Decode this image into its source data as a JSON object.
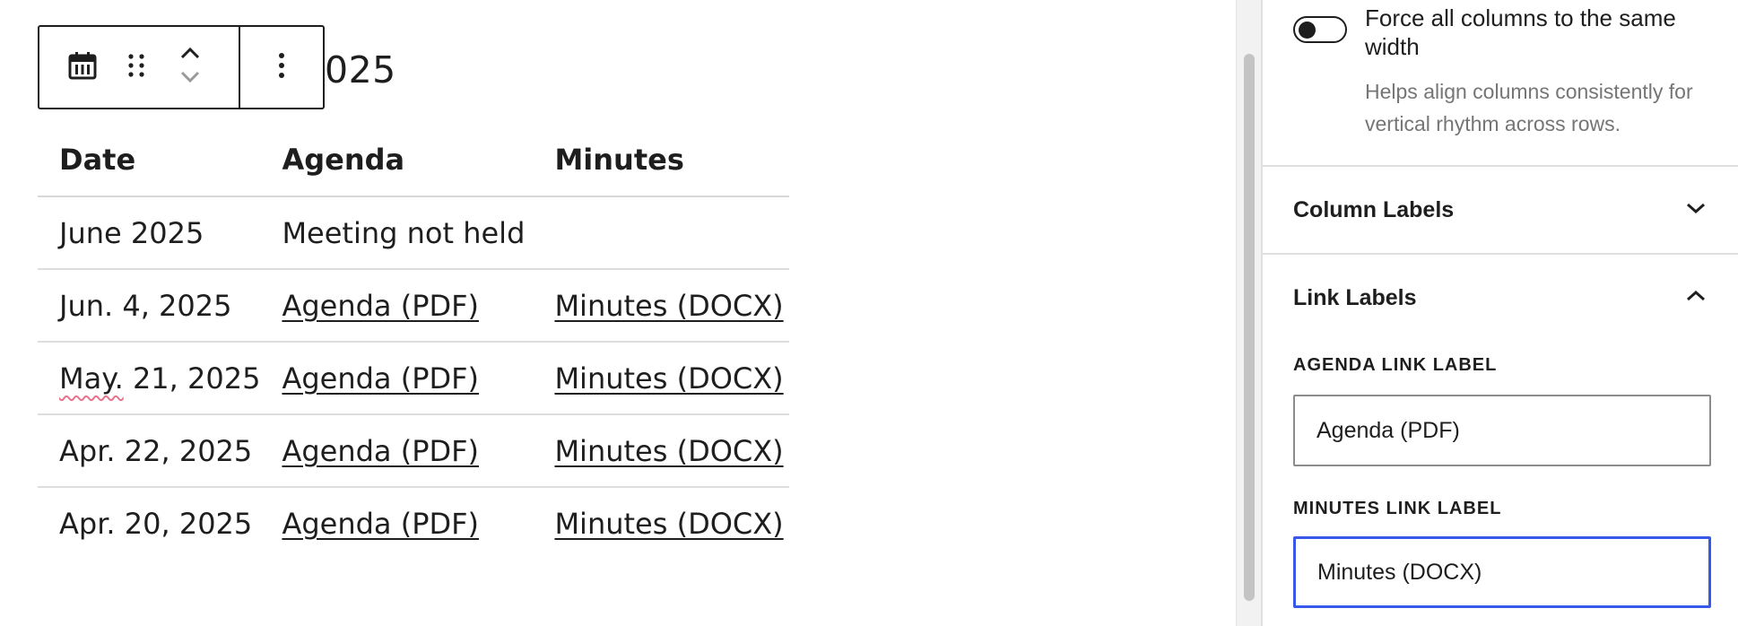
{
  "heading": {
    "visible_text": "025"
  },
  "toolbar": {
    "icons": [
      "calendar-icon",
      "drag-handle-icon",
      "move-up-icon",
      "move-down-icon",
      "more-options-icon"
    ]
  },
  "table": {
    "headers": {
      "date": "Date",
      "agenda": "Agenda",
      "minutes": "Minutes"
    },
    "rows": [
      {
        "date": "June 2025",
        "agenda": "Meeting not held",
        "minutes": ""
      },
      {
        "date": "Jun. 4, 2025",
        "agenda": "Agenda (PDF)",
        "minutes": "Minutes (DOCX)"
      },
      {
        "date_prefix": "May.",
        "date_suffix": " 21, 2025",
        "agenda": "Agenda (PDF)",
        "minutes": "Minutes (DOCX)"
      },
      {
        "date": "Apr. 22, 2025",
        "agenda": "Agenda (PDF)",
        "minutes": "Minutes (DOCX)"
      },
      {
        "date": "Apr. 20, 2025",
        "agenda": "Agenda (PDF)",
        "minutes": "Minutes (DOCX)"
      }
    ]
  },
  "sidebar": {
    "force_width": {
      "label": "Force all columns to the same width",
      "help": "Helps align columns consistently for vertical rhythm across rows.",
      "checked": false
    },
    "panels": {
      "column_labels": {
        "title": "Column Labels",
        "expanded": false
      },
      "link_labels": {
        "title": "Link Labels",
        "expanded": true
      }
    },
    "fields": {
      "agenda_label": {
        "label": "Agenda Link Label",
        "value": "Agenda (PDF)"
      },
      "minutes_label": {
        "label": "Minutes Link Label",
        "value": "Minutes (DOCX)"
      }
    }
  },
  "colors": {
    "focus": "#3858e9",
    "text": "#1e1e1e",
    "muted": "#757575",
    "spellcheck": "#e8738a"
  }
}
